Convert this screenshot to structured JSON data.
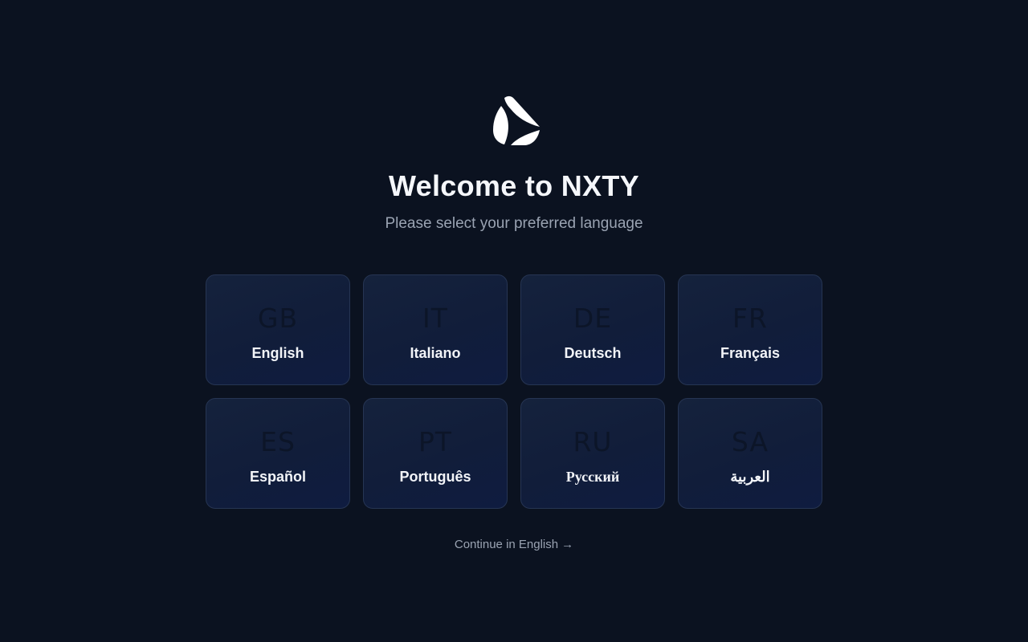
{
  "welcome": {
    "logo_icon": "nxty-logo-icon",
    "title": "Welcome to NXTY",
    "subtitle": "Please select your preferred language"
  },
  "languages": [
    {
      "code": "GB",
      "label": "English"
    },
    {
      "code": "IT",
      "label": "Italiano"
    },
    {
      "code": "DE",
      "label": "Deutsch"
    },
    {
      "code": "FR",
      "label": "Français"
    },
    {
      "code": "ES",
      "label": "Español"
    },
    {
      "code": "PT",
      "label": "Português"
    },
    {
      "code": "RU",
      "label": "Русский"
    },
    {
      "code": "SA",
      "label": "العربية"
    }
  ],
  "continue": {
    "label": "Continue in English",
    "arrow": "→",
    "arrow_icon": "arrow-right-icon"
  },
  "colors": {
    "background": "#0b1220",
    "card_border": "#263553",
    "muted_text": "#9aa3b2"
  }
}
